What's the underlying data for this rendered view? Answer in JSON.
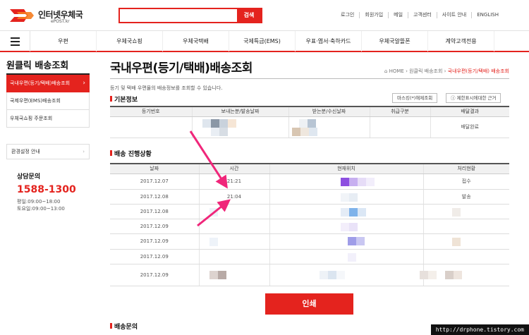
{
  "site": {
    "name": "인터넷우체국",
    "sub": "ePOST.kr",
    "search_btn": "검색",
    "search_placeholder": ""
  },
  "util": [
    "로그인",
    "회원가입",
    "메일",
    "고객센터",
    "사이트 안내",
    "ENGLISH"
  ],
  "gnb": [
    "우편",
    "우체국쇼핑",
    "우체국택배",
    "국제특급(EMS)",
    "우표·엽서·축하카드",
    "우체국알뜰폰",
    "계약고객전용"
  ],
  "sidebar": {
    "title": "원클릭 배송조회",
    "items": [
      "국내우편(등기/택배)배송조회",
      "국제우편(EMS)배송조회",
      "우체국쇼핑 주문조회"
    ],
    "env": "환경설정 안내",
    "cs_label": "상담문의",
    "cs_number": "1588-1300",
    "hours1": "평일:09:00~18:00",
    "hours2": "토요일:09:00~13:00"
  },
  "page": {
    "title": "국내우편(등기/택배)배송조회",
    "breadcrumb": [
      "HOME",
      "원클릭 배송조회",
      "국내우편(등기/택배) 배송조회"
    ],
    "desc": "등기 및 택배 우편물의 배송정보를 조회할 수 있습니다.",
    "basic_title": "기본정보",
    "btn_masking": "마스킹(*)해제조회",
    "btn_limit": "ⓘ 제한표시에대한 근거",
    "basic_headers": [
      "등기번호",
      "보내는분/발송날짜",
      "받는분/수신날짜",
      "취급구분",
      "배달결과"
    ],
    "basic_result": "배달완료",
    "progress_title": "배송 진행상황",
    "progress_headers": [
      "날짜",
      "시간",
      "현재위치",
      "처리현황"
    ],
    "rows": [
      {
        "date": "2017.12.07",
        "time": "21:21",
        "status": "접수"
      },
      {
        "date": "2017.12.08",
        "time": "21:04",
        "status": "발송"
      },
      {
        "date": "2017.12.08",
        "time": "",
        "status": ""
      },
      {
        "date": "2017.12.09",
        "time": "",
        "status": ""
      },
      {
        "date": "2017.12.09",
        "time": "",
        "status": ""
      },
      {
        "date": "2017.12.09",
        "time": "",
        "status": ""
      },
      {
        "date": "2017.12.09",
        "time": "",
        "status": ""
      }
    ],
    "print_btn": "인쇄",
    "inquiry_title": "배송문의"
  },
  "watermark": "http://drphone.tistory.com"
}
